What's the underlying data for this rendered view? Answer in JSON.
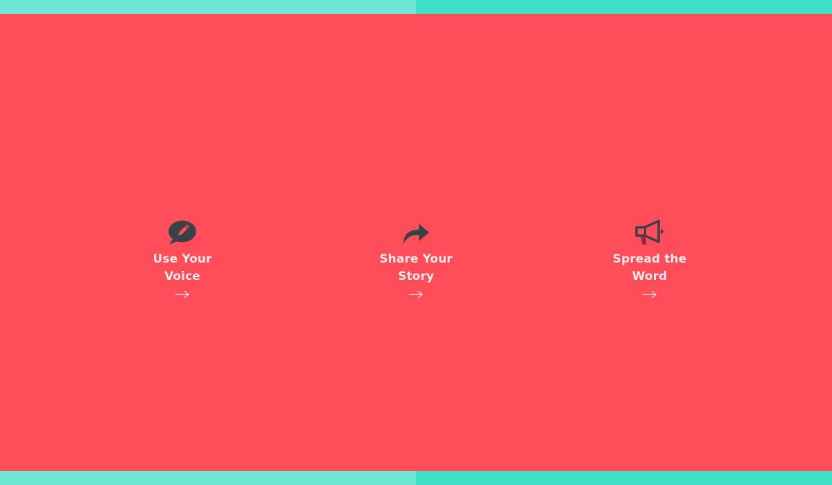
{
  "theme": {
    "background": "#ff4d5a",
    "band_left": "#6ee7d5",
    "band_right": "#40e0c7",
    "icon_color": "#3b4149",
    "text_color": "#fde8ea",
    "arrow_color": "#fde8ea"
  },
  "actions": [
    {
      "title": "Use Your Voice",
      "icon": "chat-bubble-pencil-icon",
      "arrow": "right-arrow-icon"
    },
    {
      "title": "Share Your Story",
      "icon": "share-arrow-icon",
      "arrow": "right-arrow-icon"
    },
    {
      "title": "Spread the Word",
      "icon": "megaphone-icon",
      "arrow": "right-arrow-icon"
    }
  ]
}
